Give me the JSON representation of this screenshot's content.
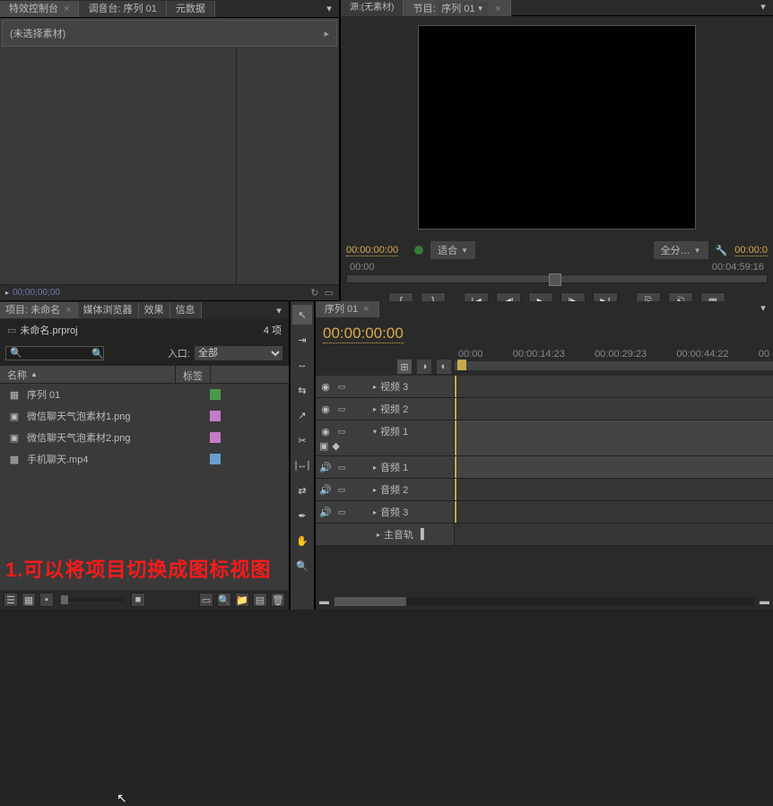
{
  "top_tabs": {
    "fx_control": "特效控制台",
    "mixer": "调音台: 序列 01",
    "metadata": "元数据"
  },
  "fx_panel": {
    "unselected": "(未选择素材)",
    "timecode": "00;00;00;00"
  },
  "preview": {
    "source_tab": "源:(无素材)",
    "program_tab": "节目:",
    "sequence_label": "序列 01",
    "timecode": "00:00:00:00",
    "fit_label": "适合",
    "full_label": "全分…",
    "ruler_start": "00:00",
    "ruler_end": "00:04:59:16",
    "tc_right": "00:00:0"
  },
  "project": {
    "tabs": {
      "project": "项目: 未命名",
      "media_browser": "媒体浏览器",
      "effects": "效果",
      "info": "信息"
    },
    "filename": "未命名.prproj",
    "item_count": "4 项",
    "entry_label": "入口:",
    "entry_value": "全部",
    "col_name": "名称",
    "col_label": "标签",
    "items": [
      {
        "name": "序列 01",
        "type": "sequence",
        "swatch": "green"
      },
      {
        "name": "微信聊天气泡素材1.png",
        "type": "image",
        "swatch": "pink"
      },
      {
        "name": "微信聊天气泡素材2.png",
        "type": "image",
        "swatch": "pink"
      },
      {
        "name": "手机聊天.mp4",
        "type": "video",
        "swatch": "blue"
      }
    ],
    "annotation": "1.可以将项目切换成图标视图"
  },
  "timeline": {
    "tab": "序列 01",
    "timecode": "00:00:00:00",
    "ruler": [
      "00:00",
      "00:00:14:23",
      "00:00:29:23",
      "00:00:44:22",
      "00"
    ],
    "tracks": {
      "v3": "视频 3",
      "v2": "视频 2",
      "v1": "视频 1",
      "a1": "音频 1",
      "a2": "音频 2",
      "a3": "音频 3",
      "master": "主音轨"
    }
  },
  "icons": {
    "search": "🔍",
    "eye": "◉",
    "speaker": "🔊",
    "play": "▶",
    "folder": "📁",
    "trash": "🗑"
  }
}
